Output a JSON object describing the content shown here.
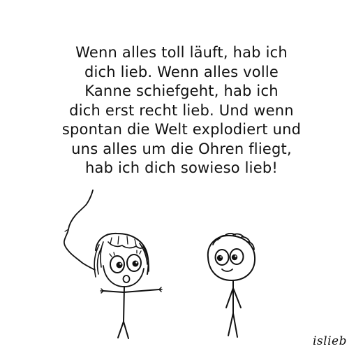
{
  "comic": {
    "speech_lines": [
      "Wenn alles toll läuft, hab ich",
      "dich lieb. Wenn alles volle",
      "Kanne schiefgeht, hab ich",
      "dich erst recht lieb. Und wenn",
      "spontan die Welt explodiert und",
      "uns alles um die Ohren fliegt,",
      "hab ich dich sowieso lieb!"
    ],
    "signature": "islieb"
  },
  "colors": {
    "ink": "#111111",
    "background": "#ffffff"
  },
  "icons": [
    "speech-tail-icon",
    "girl-figure-icon",
    "boy-figure-icon"
  ]
}
